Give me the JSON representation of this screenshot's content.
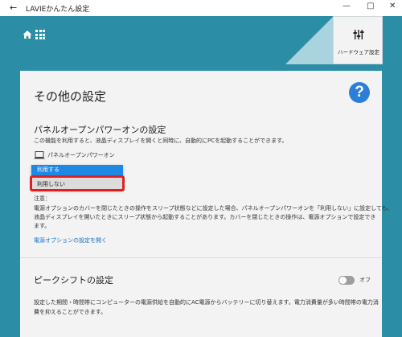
{
  "window": {
    "title": "LAVIEかんたん設定",
    "back_glyph": "←",
    "minimize_glyph": "—",
    "maximize_glyph": "□",
    "close_glyph": "✕"
  },
  "header": {
    "hardware_button_label": "ハードウェア設定"
  },
  "colors": {
    "app_background": "#2b8da6",
    "accent_blue": "#1e88e5",
    "highlight_red": "#e02020",
    "link_blue": "#1a73c7"
  },
  "page": {
    "title": "その他の設定",
    "help_glyph": "?"
  },
  "panel_poweron": {
    "title": "パネルオープンパワーオンの設定",
    "description": "この機能を利用すると、液晶ディスプレイを開くと同時に、自動的にPCを起動することができます。",
    "option_label": "パネルオープンパワーオン",
    "dropdown": {
      "options": [
        "利用する",
        "利用しない"
      ],
      "highlighted_index": 0
    },
    "note_heading": "注意：",
    "note_lines": [
      "電源オプションのカバーを閉じたときの操作をスリープ状態などに設定した場合、パネルオープンパワーオンを「利用しない」に設定しても、",
      "液晶ディスプレイを開いたときにスリープ状態から起動することがあります。カバーを閉じたときの操作は、電源オプションで設定でき",
      "ます。"
    ],
    "link_text": "電源オプションの設定を開く"
  },
  "peak_shift": {
    "title": "ピークシフトの設定",
    "toggle_label": "オフ",
    "toggle_on": false,
    "description_lines": [
      "設定した期間・時間帯にコンピューターの電源供給を自動的にAC電源からバッテリーに切り替えます。電力消費量が多い時間帯の電力消",
      "費を抑えることができます。"
    ]
  }
}
